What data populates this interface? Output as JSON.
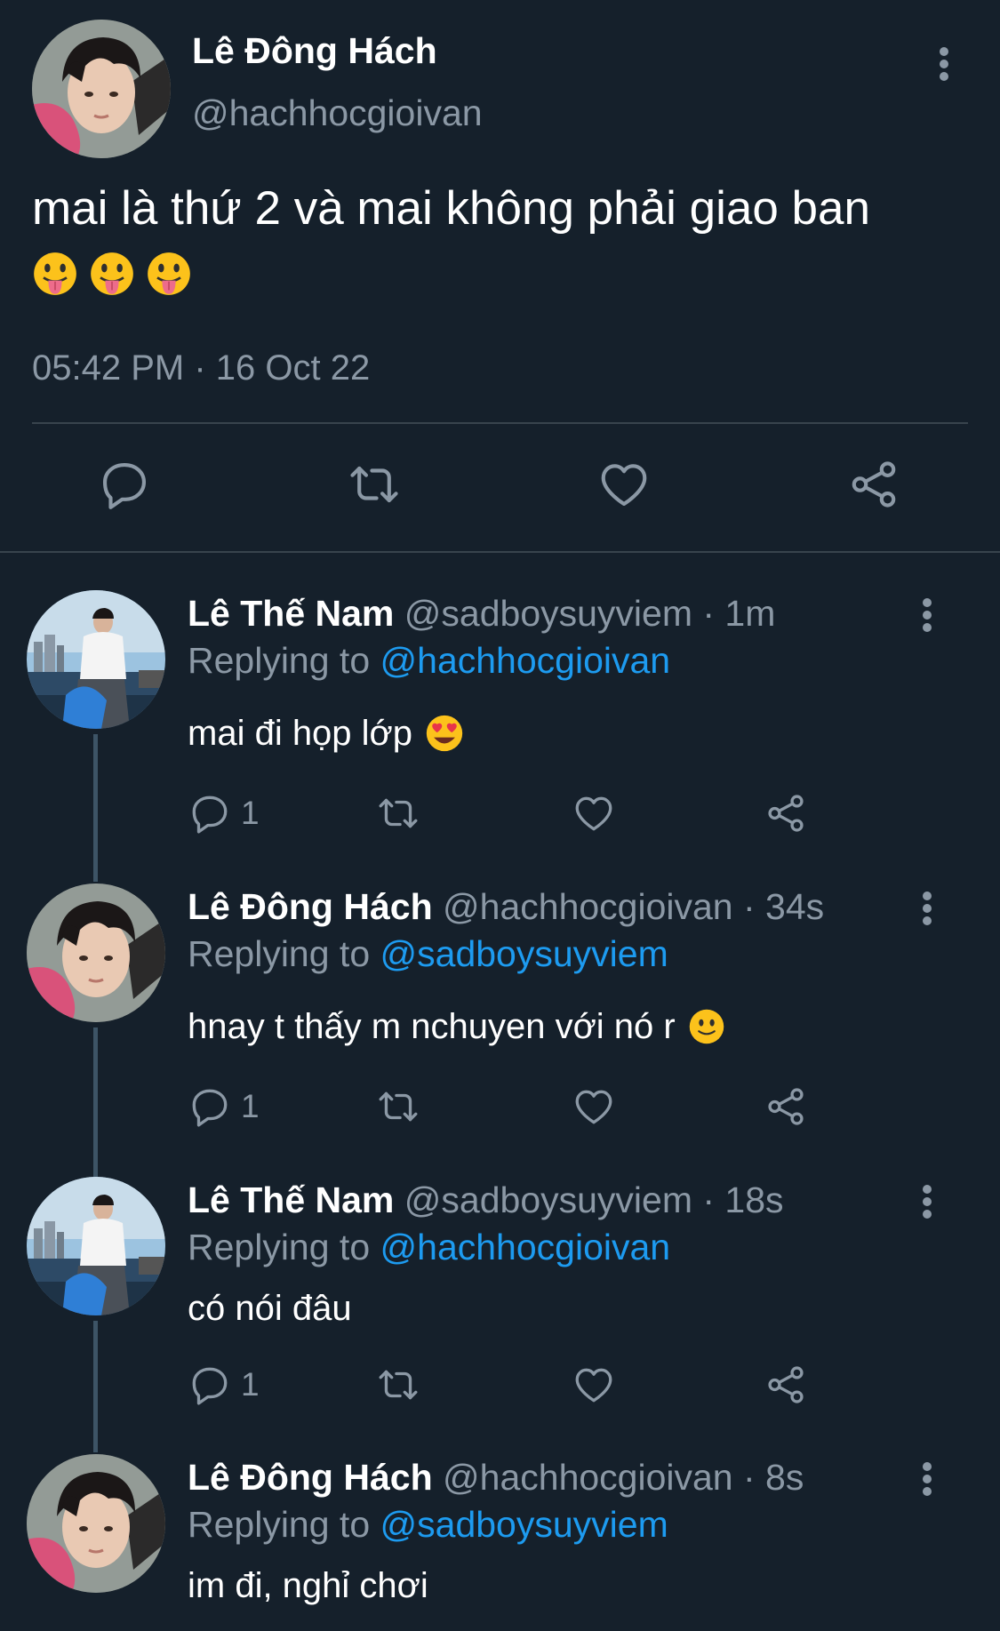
{
  "main_tweet": {
    "author_name": "Lê Đông Hách",
    "author_handle": "@hachhocgioivan",
    "text": "mai là thứ 2 và mai không phải giao ban",
    "emojis": [
      "face-with-tongue",
      "face-with-tongue",
      "face-with-tongue"
    ],
    "timestamp": "05:42 PM · 16 Oct 22"
  },
  "replies": [
    {
      "author_name": "Lê Thế Nam",
      "meta": "@sadboysuyviem · 1m",
      "replying_prefix": "Replying to",
      "replying_to": "@hachhocgioivan",
      "text": "mai đi họp lớp",
      "emoji": "heart-eyes",
      "reply_count": "1"
    },
    {
      "author_name": "Lê Đông Hách",
      "meta": "@hachhocgioivan · 34s",
      "replying_prefix": "Replying to",
      "replying_to": "@sadboysuyviem",
      "text": "hnay t thấy m nchuyen với nó r",
      "emoji": "slight-smile",
      "reply_count": "1"
    },
    {
      "author_name": "Lê Thế Nam",
      "meta": "@sadboysuyviem · 18s",
      "replying_prefix": "Replying to",
      "replying_to": "@hachhocgioivan",
      "text": "có nói đâu",
      "reply_count": "1"
    },
    {
      "author_name": "Lê Đông Hách",
      "meta": "@hachhocgioivan · 8s",
      "replying_prefix": "Replying to",
      "replying_to": "@sadboysuyviem",
      "text": "im đi, nghỉ chơi"
    }
  ],
  "colors": {
    "background": "#15202b",
    "secondary_text": "#8b98a5",
    "link": "#1d9bf0",
    "divider": "#38444d"
  }
}
